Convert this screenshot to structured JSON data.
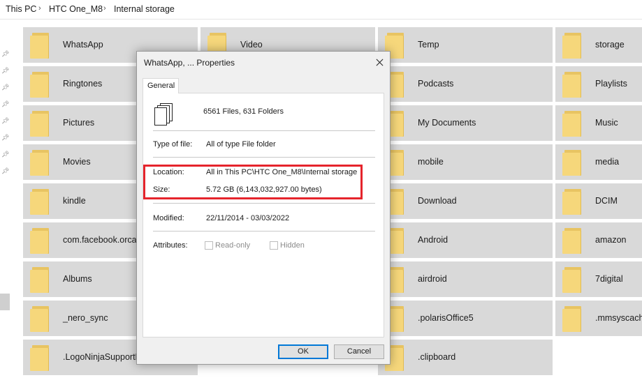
{
  "breadcrumb": [
    "This PC",
    "HTC One_M8",
    "Internal storage"
  ],
  "tiles": [
    {
      "name": "WhatsApp"
    },
    {
      "name": "Video"
    },
    {
      "name": "Temp"
    },
    {
      "name": "storage"
    },
    {
      "name": "Ringtones"
    },
    {
      "name": "Podcasts"
    },
    {
      "name": "Playlists"
    },
    {
      "name": "Pictures"
    },
    {
      "name": "My Documents"
    },
    {
      "name": "Music"
    },
    {
      "name": "Movies"
    },
    {
      "name": "mobile"
    },
    {
      "name": "media"
    },
    {
      "name": "kindle"
    },
    {
      "name": "Download"
    },
    {
      "name": "DCIM"
    },
    {
      "name": "com.facebook.orca"
    },
    {
      "name": "Android"
    },
    {
      "name": "amazon"
    },
    {
      "name": "Albums"
    },
    {
      "name": "airdroid"
    },
    {
      "name": "7digital"
    },
    {
      "name": "_nero_sync"
    },
    {
      "name": ".polarisOffice5"
    },
    {
      "name": ".mmsyscach"
    },
    {
      "name": ".LogoNinjaSupportF"
    },
    {
      "name": ".clipboard"
    }
  ],
  "dialog": {
    "title": "WhatsApp, ... Properties",
    "tab": "General",
    "summary": "6561 Files, 631 Folders",
    "type_label": "Type of file:",
    "type_value": "All of type File folder",
    "location_label": "Location:",
    "location_value": "All in This PC\\HTC One_M8\\Internal storage",
    "size_label": "Size:",
    "size_value": "5.72 GB (6,143,032,927.00 bytes)",
    "modified_label": "Modified:",
    "modified_value": "22/11/2014 - 03/03/2022",
    "attributes_label": "Attributes:",
    "readonly_label": "Read-only",
    "hidden_label": "Hidden",
    "ok_label": "OK",
    "cancel_label": "Cancel"
  },
  "colors": {
    "highlight": "#e5242c",
    "tile_bg": "#d9d9d9",
    "folder": "#f6d77b",
    "ok_border": "#0078d7"
  },
  "icons": {
    "folder": "folder-icon",
    "pin": "pin-icon",
    "close": "close-icon",
    "files": "files-icon"
  }
}
